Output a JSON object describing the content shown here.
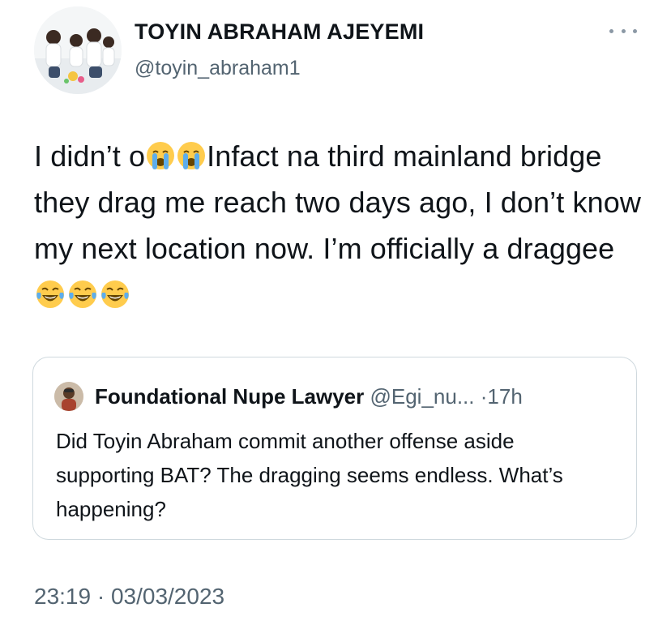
{
  "author": {
    "display_name": "TOYIN ABRAHAM AJEYEMI",
    "handle": "@toyin_abraham1"
  },
  "tweet": {
    "segments": [
      "I didn’t o",
      "Infact na third mainland bridge they drag me reach two days ago, I don’t know my next location now. I’m officially a draggee"
    ],
    "emojis": [
      "crying-face",
      "crying-face",
      "tears-of-joy",
      "tears-of-joy",
      "tears-of-joy"
    ]
  },
  "quoted_tweet": {
    "author_name": "Foundational Nupe Lawyer",
    "handle": "@Egi_nu...",
    "separator": "·",
    "time": "17h",
    "text": "Did Toyin Abraham commit another offense aside supporting BAT? The dragging seems endless. What’s happening?"
  },
  "timestamp": "23:19 · 03/03/2023",
  "colors": {
    "text_primary": "#0f1419",
    "text_secondary": "#536471",
    "border": "#cfd9de",
    "emoji_yellow": "#ffcc4d",
    "emoji_tear": "#5dadec"
  }
}
